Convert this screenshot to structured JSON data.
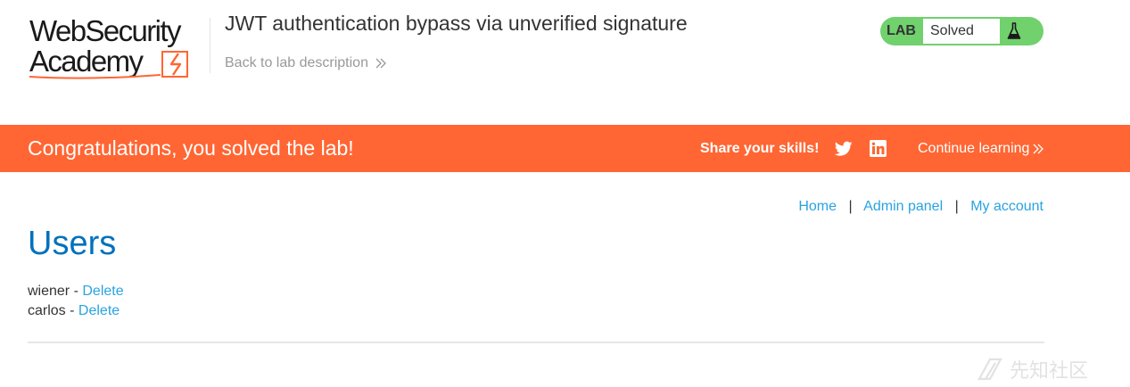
{
  "header": {
    "logo_line1": "WebSecurity",
    "logo_line2": "Academy",
    "lab_title": "JWT authentication bypass via unverified signature",
    "back_link": "Back to lab description",
    "lab_status": {
      "tag": "LAB",
      "state": "Solved",
      "icon": "flask-icon"
    }
  },
  "banner": {
    "message": "Congratulations, you solved the lab!",
    "share_label": "Share your skills!",
    "share_icons": [
      "twitter-icon",
      "linkedin-icon"
    ],
    "continue_label": "Continue learning"
  },
  "nav": {
    "home": "Home",
    "separator": "|",
    "admin": "Admin panel",
    "account": "My account"
  },
  "main": {
    "title": "Users",
    "users": [
      {
        "name": "wiener",
        "separator": "-",
        "action": "Delete"
      },
      {
        "name": "carlos",
        "separator": "-",
        "action": "Delete"
      }
    ]
  },
  "colors": {
    "banner": "#ff6633",
    "link": "#29a3e0",
    "title": "#0071bc",
    "solved": "#70d16d"
  },
  "watermark": "先知社区"
}
